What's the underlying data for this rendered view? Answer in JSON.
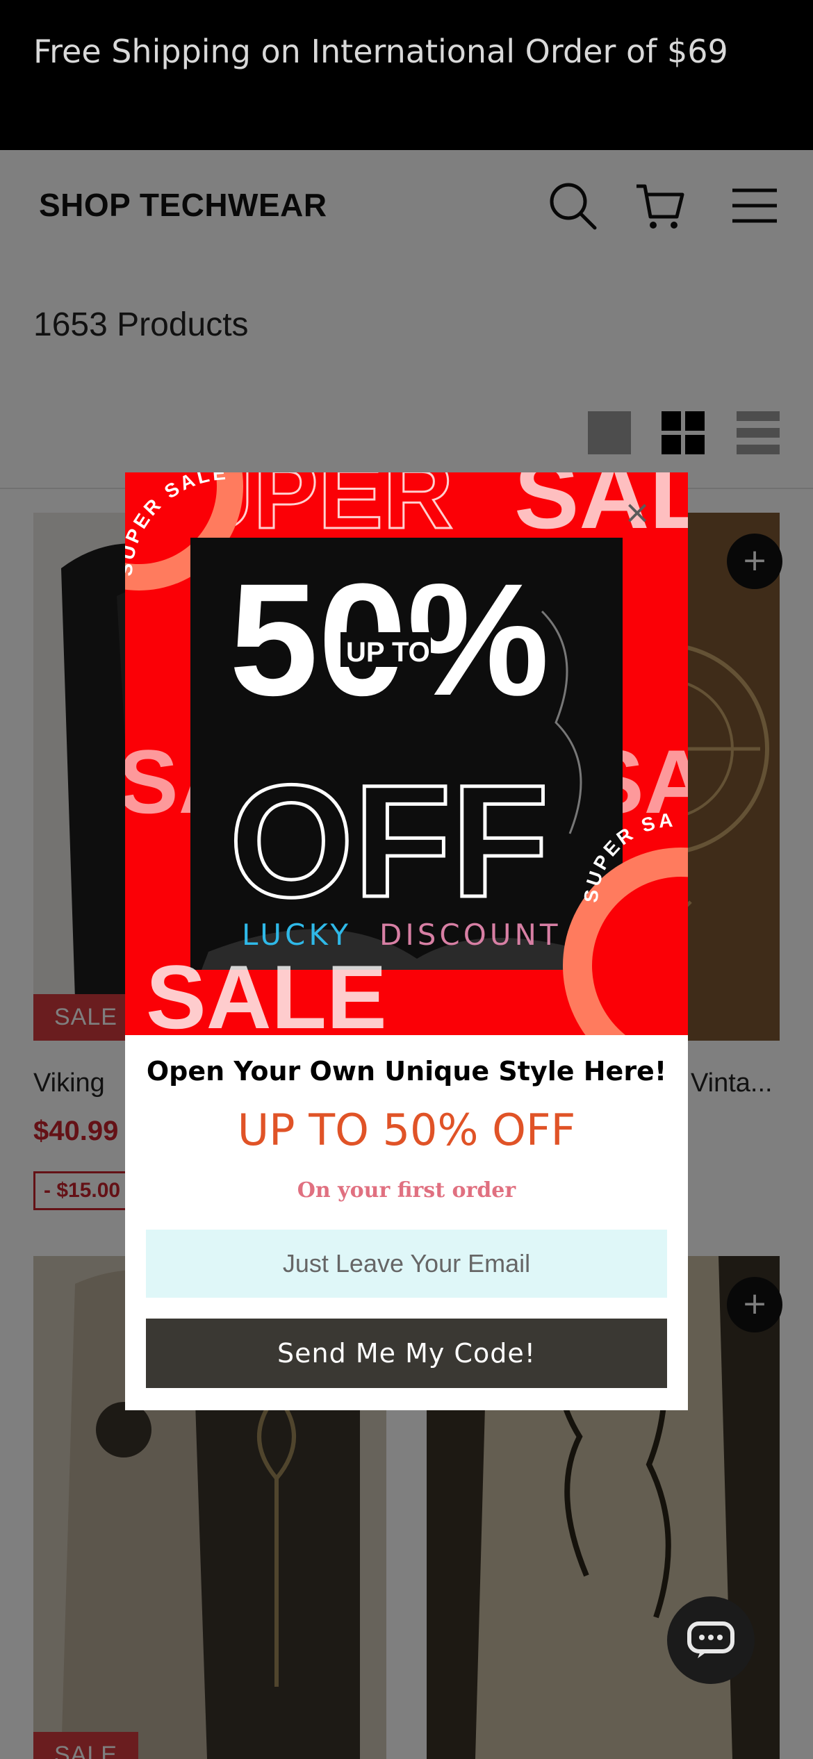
{
  "announcement": {
    "text": "Free Shipping on International Order of $69"
  },
  "header": {
    "logo": "SHOP TECHWEAR",
    "icons": [
      "search-icon",
      "cart-icon",
      "menu-icon"
    ]
  },
  "collection": {
    "product_count": "1653 Products",
    "view_modes": [
      "single-view",
      "grid-view",
      "list-view"
    ],
    "active_view": "grid-view"
  },
  "products": [
    {
      "title": "Viking",
      "price": "$40.99",
      "save": "- $15.00",
      "badge": "SALE"
    },
    {
      "title": "Vinta...",
      "badge": ""
    },
    {
      "badge": "SALE"
    },
    {
      "badge": ""
    }
  ],
  "popup": {
    "banner_text": {
      "super": "SUPER",
      "sale": "SALE",
      "big_number": "50%",
      "up_to": "UP TO",
      "off": "OFF",
      "lucky": "LUCKY",
      "discount": "DISCOUNT",
      "ring": "SUPER SALE"
    },
    "close": "×",
    "headline": "Open Your Own Unique Style Here!",
    "offer": "UP TO 50% OFF",
    "subtext": "On your first order",
    "email_placeholder": "Just Leave Your Email",
    "submit_label": "Send Me My Code!"
  },
  "colors": {
    "banner_red": "#fb0006",
    "offer_orange": "#e05327",
    "subtext_pink": "#e07080",
    "email_bg": "#dff7f8",
    "submit_bg": "#3a3833",
    "sale_red": "#c8232c"
  }
}
